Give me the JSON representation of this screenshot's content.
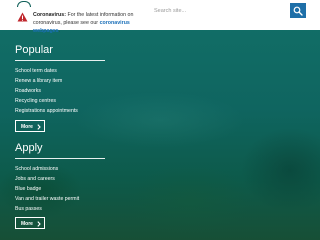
{
  "notice": {
    "title": "Coronavirus:",
    "text_before": "For the latest information on coronavirus, please see our",
    "link_text": "coronavirus webpages",
    "text_after": "."
  },
  "search": {
    "placeholder": "Search site..."
  },
  "popular": {
    "heading": "Popular",
    "links": [
      "School term dates",
      "Renew a library item",
      "Roadworks",
      "Recycling centres",
      "Registrations appointments"
    ],
    "more_label": "More"
  },
  "apply": {
    "heading": "Apply",
    "links": [
      "School admissions",
      "Jobs and careers",
      "Blue badge",
      "Van and trailer waste permit",
      "Bus passes"
    ],
    "more_label": "More"
  },
  "colors": {
    "background": "#0f5f58",
    "alert_icon": "#c0272d",
    "link": "#1a6fb8",
    "search_button": "#1e6fa8"
  },
  "icons": {
    "alert": "warning-triangle-icon",
    "search": "magnifier-icon",
    "more": "chevron-right-icon"
  }
}
